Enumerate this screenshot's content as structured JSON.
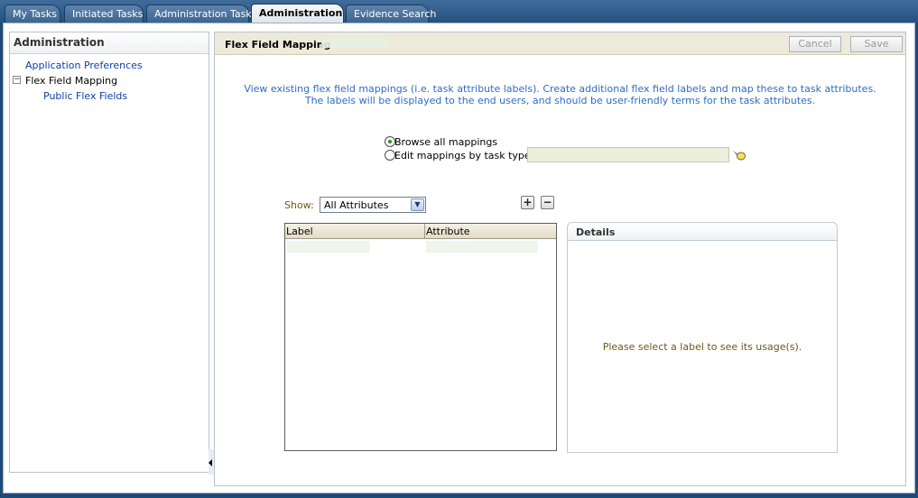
{
  "tabs": [
    {
      "label": "My Tasks",
      "active": false
    },
    {
      "label": "Initiated Tasks",
      "active": false
    },
    {
      "label": "Administration Tasks",
      "active": false
    },
    {
      "label": "Administration",
      "active": true
    },
    {
      "label": "Evidence Search",
      "active": false
    }
  ],
  "sidebar": {
    "title": "Administration",
    "items": [
      {
        "label": "Application Preferences"
      },
      {
        "label": "Flex Field Mapping",
        "expanded": true
      },
      {
        "label": "Public Flex Fields"
      }
    ]
  },
  "main": {
    "title": "Flex Field Mapping",
    "cancel_label": "Cancel",
    "save_label": "Save",
    "intro_line1": "View existing flex field mappings (i.e. task attribute labels). Create additional flex field labels and map these to task attributes.",
    "intro_line2": "The labels will be displayed to the end users, and should be user-friendly terms for the task attributes.",
    "radio_browse": "Browse all mappings",
    "radio_edit": "Edit mappings by task type:",
    "selected_radio": "browse",
    "task_type_value": "",
    "show_label": "Show:",
    "show_value": "All Attributes",
    "add_symbol": "+",
    "remove_symbol": "−",
    "table": {
      "col_label": "Label",
      "col_attribute": "Attribute"
    },
    "details": {
      "title": "Details",
      "message": "Please select a label to see its usage(s)."
    }
  }
}
